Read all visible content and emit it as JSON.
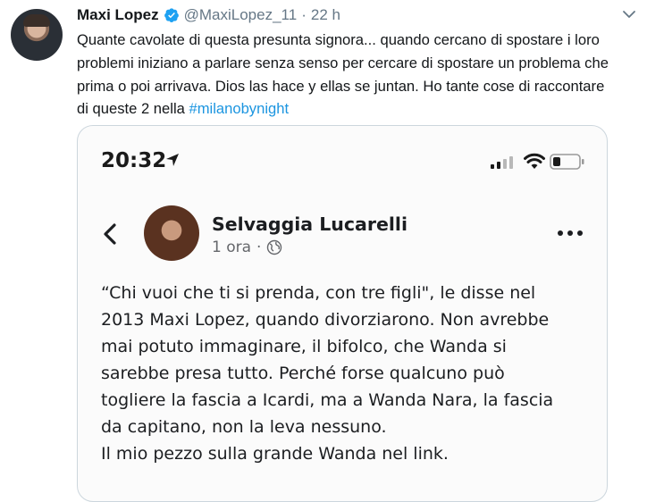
{
  "tweet": {
    "author_name": "Maxi Lopez",
    "handle": "@MaxiLopez_11",
    "separator": "·",
    "time": "22 h",
    "text_lines": [
      "Quante cavolate di questa presunta signora... quando cercano di spostare i loro",
      "problemi iniziano a parlare senza senso per cercare di spostare un problema che",
      "prima o poi arrivava. Dios las hace y ellas se juntan. Ho tante cose di raccontare",
      "di queste 2 nella "
    ],
    "hashtag": "#milanobynight",
    "colors": {
      "link": "#1b95e0",
      "verified": "#1da1f2",
      "muted": "#657786"
    }
  },
  "screenshot": {
    "status_time": "20:32",
    "post_author": "Selvaggia Lucarelli",
    "post_age": "1 ora",
    "post_sep": "·",
    "post_lines": [
      "“Chi vuoi che ti si prenda, con tre figli\", le disse nel",
      "2013 Maxi Lopez, quando divorziarono. Non avrebbe",
      "mai potuto immaginare, il bifolco, che Wanda si",
      "sarebbe presa tutto. Perché forse qualcuno può",
      "togliere la fascia a Icardi, ma a Wanda Nara, la fascia",
      "da capitano, non la leva nessuno.",
      "Il mio pezzo sulla grande Wanda nel link."
    ]
  }
}
